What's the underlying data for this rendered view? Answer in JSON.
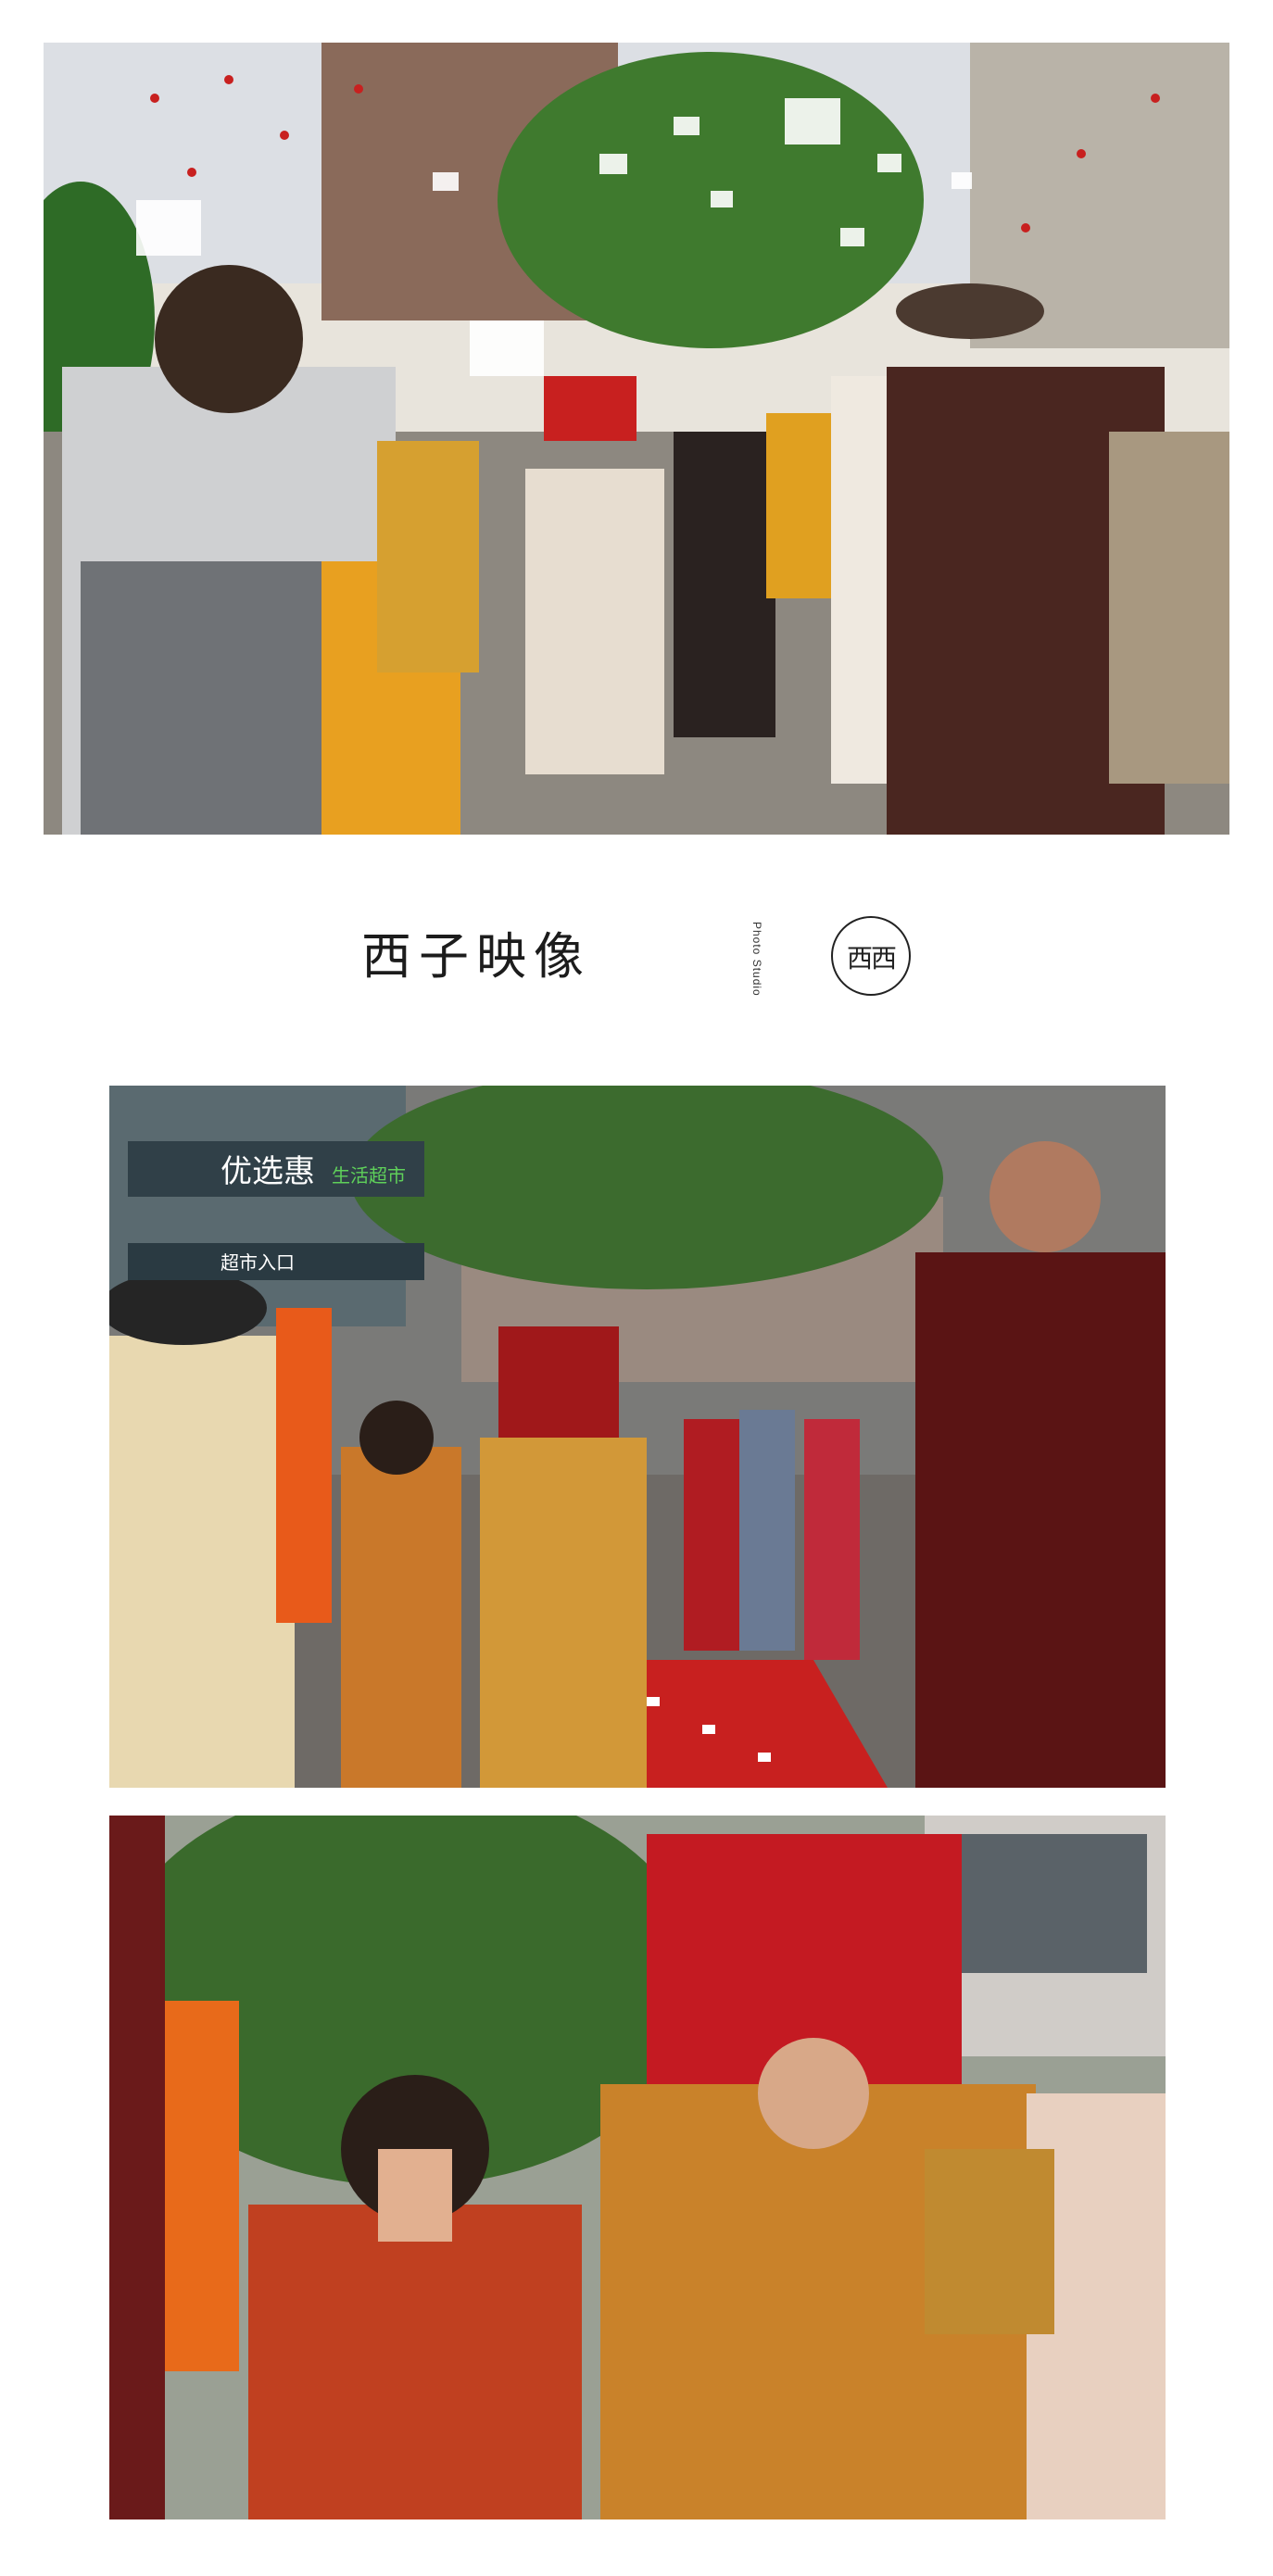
{
  "photos": [
    {
      "id": "procession",
      "subject": "wedding procession with confetti"
    },
    {
      "id": "greeting",
      "subject": "couple bowing to lama on street"
    },
    {
      "id": "blessing",
      "subject": "bride and groom praying"
    }
  ],
  "brand": {
    "name": "西子映像",
    "subtitle": "Photo Studio",
    "seal": "西西"
  },
  "scene_text": {
    "store_sign": "优选惠",
    "store_sign_sub": "生活超市",
    "store_entrance": "超市入口"
  },
  "colors": {
    "background": "#ffffff",
    "accent_red": "#c8201f",
    "accent_gold": "#e0a020",
    "brand_text": "#1c1c1c"
  }
}
